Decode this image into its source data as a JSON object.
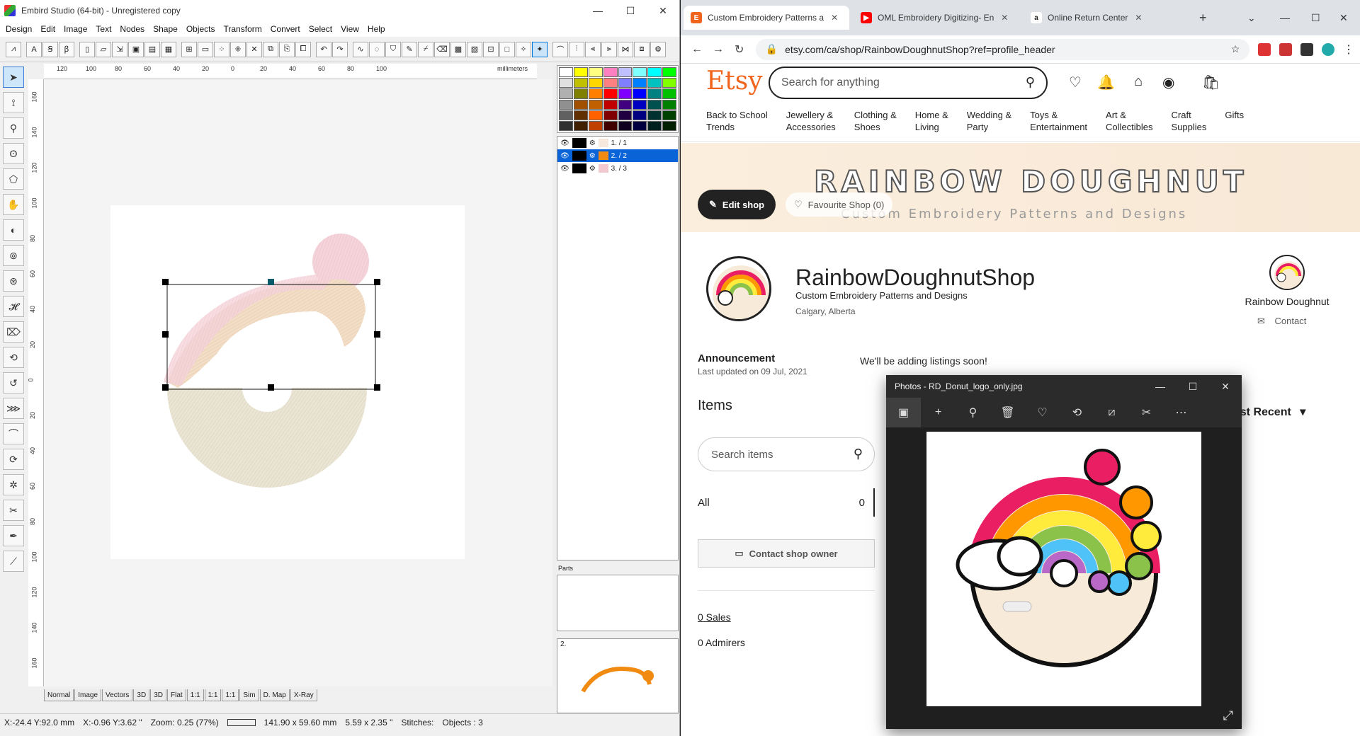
{
  "embird": {
    "title": "Embird Studio (64-bit)  - Unregistered copy",
    "menu": [
      "Design",
      "Edit",
      "Image",
      "Text",
      "Nodes",
      "Shape",
      "Objects",
      "Transform",
      "Convert",
      "Select",
      "View",
      "Help"
    ],
    "ruler_top": [
      "120",
      "100",
      "80",
      "60",
      "40",
      "20",
      "0",
      "20",
      "40",
      "60",
      "80",
      "100"
    ],
    "ruler_unit": "millimeters",
    "ruler_left": [
      "160",
      "140",
      "120",
      "100",
      "80",
      "60",
      "40",
      "20",
      "0",
      "20",
      "40",
      "60",
      "80",
      "100",
      "120",
      "140",
      "160"
    ],
    "objects": [
      {
        "label": "1.  / 1",
        "color": "#f6e8dc"
      },
      {
        "label": "2.  / 2",
        "color": "#f08a10"
      },
      {
        "label": "3.  / 3",
        "color": "#f3c9d1"
      }
    ],
    "parts_label": "Parts",
    "preview_label": "2.",
    "bottom_tabs": [
      "Normal",
      "Image",
      "Vectors",
      "3D",
      "3D",
      "Flat",
      "1:1",
      "1:1",
      "1:1",
      "Sim",
      "D. Map",
      "X-Ray"
    ],
    "status": {
      "coords_mm": "X:-24.4  Y:92.0 mm",
      "coords_in": "X:-0.96  Y:3.62 \"",
      "zoom": "Zoom:  0.25 (77%)",
      "size_mm": "141.90 x 59.60 mm",
      "size_in": "5.59 x 2.35 \"",
      "stitches": "Stitches:",
      "objects": "Objects : 3"
    }
  },
  "chrome": {
    "tabs": [
      {
        "title": "Custom Embroidery Patterns a",
        "favicon": "E",
        "color": "#f1641e"
      },
      {
        "title": "OML Embroidery Digitizing- En",
        "favicon": "▶",
        "color": "#ff0000"
      },
      {
        "title": "Online Return Center",
        "favicon": "a",
        "color": "#222"
      }
    ],
    "url": "etsy.com/ca/shop/RainbowDoughnutShop?ref=profile_header"
  },
  "etsy": {
    "logo": "Etsy",
    "search_placeholder": "Search for anything",
    "categories": [
      [
        "Back to School",
        "Trends"
      ],
      [
        "Jewellery &",
        "Accessories"
      ],
      [
        "Clothing &",
        "Shoes"
      ],
      [
        "Home &",
        "Living"
      ],
      [
        "Wedding &",
        "Party"
      ],
      [
        "Toys &",
        "Entertainment"
      ],
      [
        "Art &",
        "Collectibles"
      ],
      [
        "Craft",
        "Supplies"
      ],
      [
        "Gifts"
      ]
    ],
    "banner_title": "RAINBOW DOUGHNUT",
    "banner_subtitle": "Custom Embroidery Patterns and Designs",
    "edit_shop": "Edit shop",
    "favourite_shop": "Favourite Shop (0)",
    "shop_name": "RainbowDoughnutShop",
    "shop_tagline": "Custom Embroidery Patterns and Designs",
    "shop_location": "Calgary, Alberta",
    "owner_name": "Rainbow Doughnut",
    "owner_contact": "Contact",
    "announcement_title": "Announcement",
    "announcement_date": "Last updated on 09 Jul, 2021",
    "announcement_text": "We'll be adding listings soon!",
    "items_title": "Items",
    "items_search_placeholder": "Search items",
    "all_label": "All",
    "all_count": "0",
    "contact_owner": "Contact shop owner",
    "sales": "0 Sales",
    "admirers": "0 Admirers",
    "sort_label": "ost Recent"
  },
  "photos": {
    "title": "Photos - RD_Donut_logo_only.jpg"
  }
}
